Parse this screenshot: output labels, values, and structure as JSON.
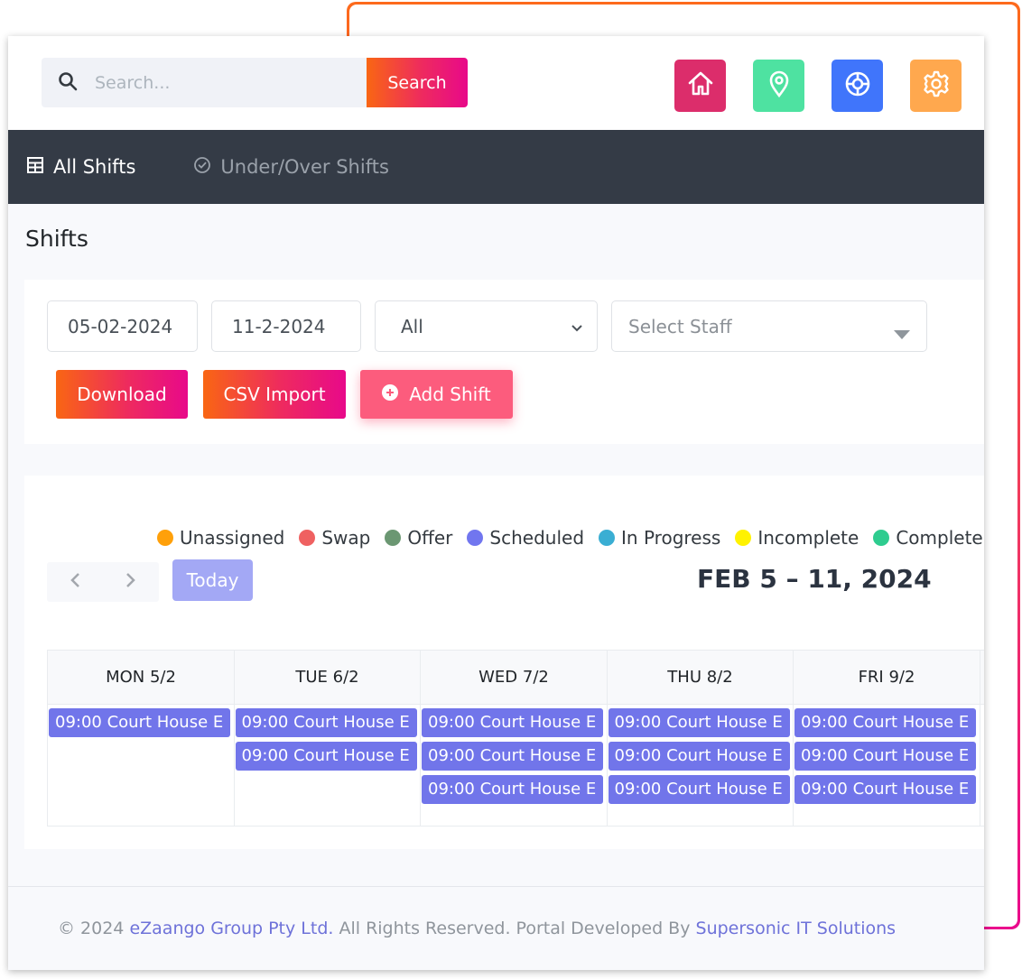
{
  "search": {
    "placeholder": "Search...",
    "value": "",
    "button_label": "Search"
  },
  "header_icons": [
    {
      "name": "home-icon",
      "color": "#dc2d6b"
    },
    {
      "name": "location-pin-icon",
      "color": "#4ee2a1"
    },
    {
      "name": "lifebuoy-icon",
      "color": "#4075fb"
    },
    {
      "name": "gear-icon",
      "color": "#ffa84e"
    }
  ],
  "nav": {
    "tabs": [
      {
        "label": "All Shifts",
        "active": true
      },
      {
        "label": "Under/Over Shifts",
        "active": false
      }
    ]
  },
  "page": {
    "title": "Shifts"
  },
  "filters": {
    "start_date": "05-02-2024",
    "end_date": "11-2-2024",
    "status_select": "All",
    "staff_placeholder": "Select Staff"
  },
  "actions": {
    "download_label": "Download",
    "csv_import_label": "CSV Import",
    "add_shift_label": "Add Shift"
  },
  "legend": [
    {
      "label": "Unassigned",
      "color": "#ffa00a"
    },
    {
      "label": "Swap",
      "color": "#ef6161"
    },
    {
      "label": "Offer",
      "color": "#6b9772"
    },
    {
      "label": "Scheduled",
      "color": "#7176ef"
    },
    {
      "label": "In Progress",
      "color": "#3aaed3"
    },
    {
      "label": "Incomplete",
      "color": "#fff200"
    },
    {
      "label": "Complete",
      "color": "#2ecc8f"
    }
  ],
  "calendar": {
    "prev_label": "<",
    "next_label": ">",
    "today_label": "Today",
    "range_title": "FEB 5 – 11, 2024",
    "days": [
      {
        "label": "MON 5/2",
        "events": [
          "09:00 Court House E"
        ]
      },
      {
        "label": "TUE 6/2",
        "events": [
          "09:00 Court House E",
          "09:00 Court House E"
        ]
      },
      {
        "label": "WED 7/2",
        "events": [
          "09:00 Court House E",
          "09:00 Court House E",
          "09:00 Court House E"
        ]
      },
      {
        "label": "THU 8/2",
        "events": [
          "09:00 Court House E",
          "09:00 Court House E",
          "09:00 Court House E"
        ]
      },
      {
        "label": "FRI 9/2",
        "events": [
          "09:00 Court House E",
          "09:00 Court House E",
          "09:00 Court House E"
        ]
      }
    ]
  },
  "footer": {
    "prefix": "© 2024",
    "company": "eZaango Group Pty Ltd.",
    "middle": "All Rights Reserved. Portal Developed By",
    "developer": "Supersonic IT Solutions"
  }
}
